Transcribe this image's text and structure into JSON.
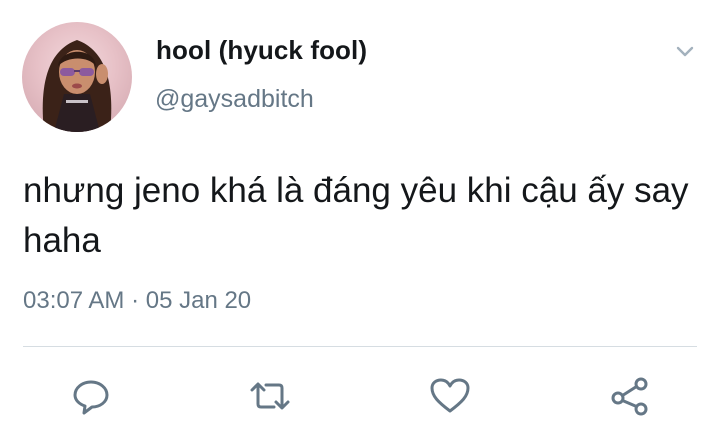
{
  "tweet": {
    "display_name": "hool (hyuck fool)",
    "handle": "@gaysadbitch",
    "text": "nhưng jeno khá là đáng yêu khi cậu ấy say haha",
    "timestamp": "03:07 AM · 05 Jan 20"
  },
  "icons": {
    "menu": "chevron-down-icon",
    "reply": "comment-icon",
    "retweet": "retweet-icon",
    "like": "heart-icon",
    "share": "share-icon"
  },
  "colors": {
    "primary_text": "#14171a",
    "secondary_text": "#657786",
    "icon": "#657786",
    "divider": "#d6dde2",
    "background": "#ffffff"
  }
}
